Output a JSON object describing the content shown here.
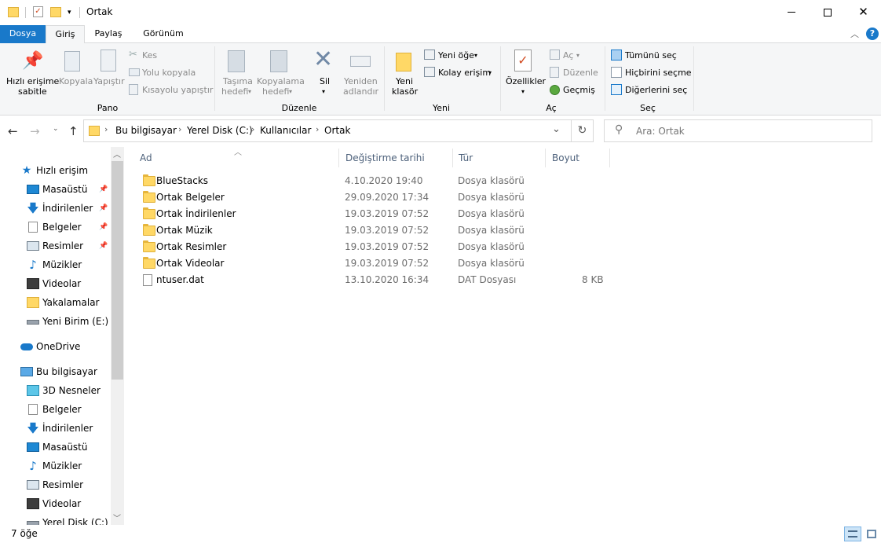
{
  "window": {
    "title": "Ortak",
    "controls": {
      "minimize": "minimize-icon",
      "maximize": "maximize-icon",
      "close": "close-icon"
    }
  },
  "ribbon_tabs": [
    "Dosya",
    "Giriş",
    "Paylaş",
    "Görünüm"
  ],
  "ribbon": {
    "pano": {
      "name": "Pano",
      "pin_line1": "Hızlı erişime",
      "pin_line2": "sabitle",
      "copy": "Kopyala",
      "paste": "Yapıştır",
      "cut": "Kes",
      "copy_path": "Yolu kopyala",
      "paste_shortcut": "Kısayolu yapıştır"
    },
    "duzenle": {
      "name": "Düzenle",
      "move_line1": "Taşıma",
      "move_line2": "hedefi",
      "copyto_line1": "Kopyalama",
      "copyto_line2": "hedefi",
      "delete": "Sil",
      "rename_line1": "Yeniden",
      "rename_line2": "adlandır"
    },
    "yeni": {
      "name": "Yeni",
      "newfolder_line1": "Yeni",
      "newfolder_line2": "klasör",
      "new_item": "Yeni öğe",
      "easy_access": "Kolay erişim"
    },
    "ac": {
      "name": "Aç",
      "properties": "Özellikler",
      "open": "Aç",
      "edit": "Düzenle",
      "history": "Geçmiş"
    },
    "sec": {
      "name": "Seç",
      "select_all": "Tümünü seç",
      "select_none": "Hiçbirini seçme",
      "invert": "Diğerlerini seç"
    }
  },
  "breadcrumb": [
    "Bu bilgisayar",
    "Yerel Disk (C:)",
    "Kullanıcılar",
    "Ortak"
  ],
  "search": {
    "placeholder": "Ara: Ortak"
  },
  "sidebar": {
    "quick_access": "Hızlı erişim",
    "quick_items": [
      "Masaüstü",
      "İndirilenler",
      "Belgeler",
      "Resimler",
      "Müzikler",
      "Videolar",
      "Yakalamalar",
      "Yeni Birim (E:)"
    ],
    "onedrive": "OneDrive",
    "this_pc": "Bu bilgisayar",
    "pc_items": [
      "3D Nesneler",
      "Belgeler",
      "İndirilenler",
      "Masaüstü",
      "Müzikler",
      "Resimler",
      "Videolar",
      "Yerel Disk (C:)"
    ]
  },
  "columns": {
    "name": "Ad",
    "date": "Değiştirme tarihi",
    "type": "Tür",
    "size": "Boyut"
  },
  "files": [
    {
      "name": "BlueStacks",
      "date": "4.10.2020 19:40",
      "type": "Dosya klasörü",
      "size": "",
      "icon": "folder-icon"
    },
    {
      "name": "Ortak Belgeler",
      "date": "29.09.2020 17:34",
      "type": "Dosya klasörü",
      "size": "",
      "icon": "folder-icon"
    },
    {
      "name": "Ortak İndirilenler",
      "date": "19.03.2019 07:52",
      "type": "Dosya klasörü",
      "size": "",
      "icon": "folder-icon"
    },
    {
      "name": "Ortak Müzik",
      "date": "19.03.2019 07:52",
      "type": "Dosya klasörü",
      "size": "",
      "icon": "folder-icon"
    },
    {
      "name": "Ortak Resimler",
      "date": "19.03.2019 07:52",
      "type": "Dosya klasörü",
      "size": "",
      "icon": "folder-icon"
    },
    {
      "name": "Ortak Videolar",
      "date": "19.03.2019 07:52",
      "type": "Dosya klasörü",
      "size": "",
      "icon": "folder-icon"
    },
    {
      "name": "ntuser.dat",
      "date": "13.10.2020 16:34",
      "type": "DAT Dosyası",
      "size": "8 KB",
      "icon": "file-icon"
    }
  ],
  "status": {
    "count": "7 öğe"
  },
  "colors": {
    "accent": "#1979ca",
    "folder": "#ffd866",
    "header_text": "#4c607a"
  }
}
